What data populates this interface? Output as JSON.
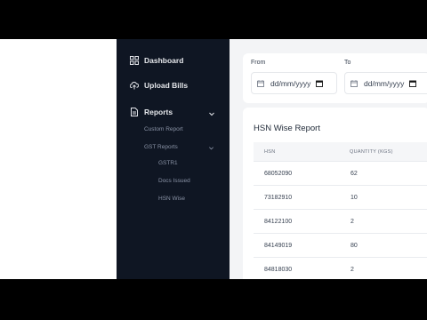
{
  "sidebar": {
    "items": [
      {
        "label": "Dashboard",
        "icon": "grid-icon"
      },
      {
        "label": "Upload Bills",
        "icon": "cloud-upload-icon"
      },
      {
        "label": "Reports",
        "icon": "document-icon"
      }
    ],
    "reports_submenu": [
      {
        "label": "Custom Report"
      },
      {
        "label": "GST Reports"
      }
    ],
    "gst_submenu": [
      {
        "label": "GSTR1"
      },
      {
        "label": "Docs Issued"
      },
      {
        "label": "HSN Wise"
      }
    ]
  },
  "filters": {
    "from_label": "From",
    "from_value": "dd/mm/yyyy",
    "to_label": "To",
    "to_value": "dd/mm/yyyy"
  },
  "report": {
    "title": "HSN Wise Report",
    "columns": [
      "HSN",
      "QUANTITY (KGS)"
    ],
    "rows": [
      [
        "68052090",
        "62"
      ],
      [
        "73182910",
        "10"
      ],
      [
        "84122100",
        "2"
      ],
      [
        "84149019",
        "80"
      ],
      [
        "84818030",
        "2"
      ]
    ]
  },
  "colors": {
    "sidebar_bg": "#0f1623",
    "main_bg": "#f3f4f6"
  }
}
